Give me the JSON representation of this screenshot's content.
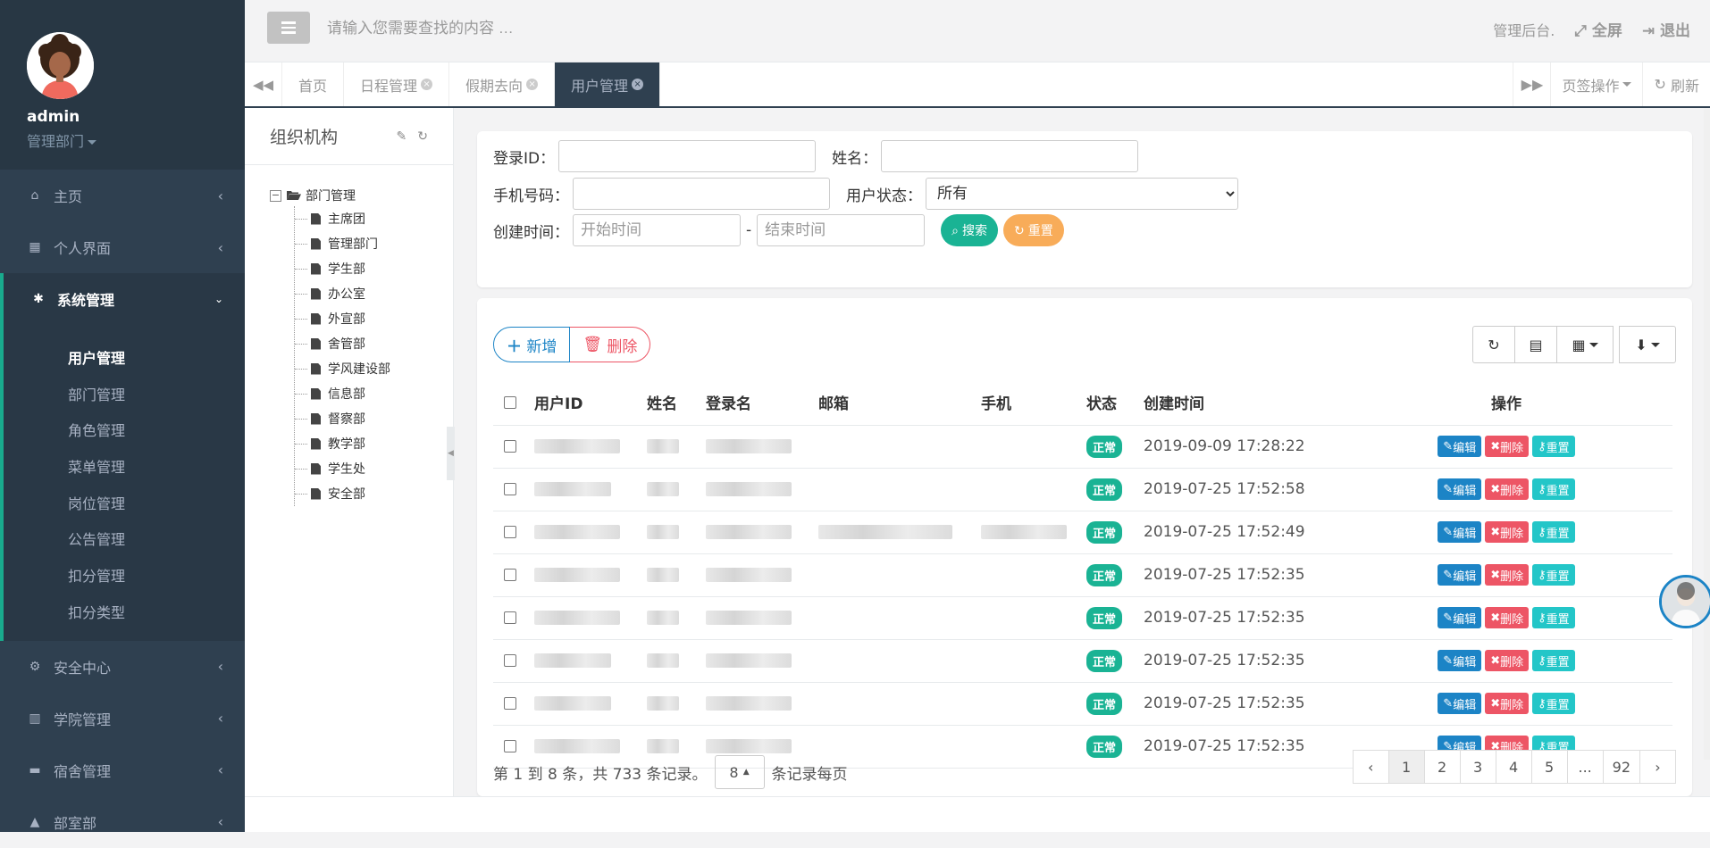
{
  "user": {
    "name": "admin",
    "dept": "管理部门"
  },
  "sidebar": {
    "items": [
      {
        "label": "主页",
        "icon": "home-icon"
      },
      {
        "label": "个人界面",
        "icon": "calendar-icon"
      },
      {
        "label": "系统管理",
        "icon": "gear-icon"
      },
      {
        "label": "安全中心",
        "icon": "gears-icon"
      },
      {
        "label": "学院管理",
        "icon": "bank-icon"
      },
      {
        "label": "宿舍管理",
        "icon": "bed-icon"
      },
      {
        "label": "部室部",
        "icon": "bell-icon"
      }
    ],
    "submenu": [
      "用户管理",
      "部门管理",
      "角色管理",
      "菜单管理",
      "岗位管理",
      "公告管理",
      "扣分管理",
      "扣分类型"
    ]
  },
  "topbar": {
    "search_placeholder": "请输入您需要查找的内容 …",
    "admin_label": "管理后台.",
    "fullscreen": "全屏",
    "logout": "退出"
  },
  "tabs": {
    "items": [
      "首页",
      "日程管理",
      "假期去向",
      "用户管理"
    ],
    "page_ops": "页签操作",
    "refresh": "刷新"
  },
  "tree": {
    "title": "组织机构",
    "root": "部门管理",
    "children": [
      "主席团",
      "管理部门",
      "学生部",
      "办公室",
      "外宣部",
      "舍管部",
      "学风建设部",
      "信息部",
      "督察部",
      "教学部",
      "学生处",
      "安全部"
    ]
  },
  "filters": {
    "login_id_label": "登录ID：",
    "name_label": "姓名：",
    "phone_label": "手机号码：",
    "status_label": "用户状态：",
    "status_value": "所有",
    "time_label": "创建时间：",
    "start_placeholder": "开始时间",
    "end_placeholder": "结束时间",
    "dash": "-",
    "search_btn": "搜索",
    "reset_btn": "重置"
  },
  "toolbar": {
    "add": "新增",
    "delete": "删除"
  },
  "table": {
    "headers": [
      "用户ID",
      "姓名",
      "登录名",
      "邮箱",
      "手机",
      "状态",
      "创建时间",
      "操作"
    ],
    "rows": [
      {
        "status": "正常",
        "created": "2019-09-09 17:28:22"
      },
      {
        "status": "正常",
        "created": "2019-07-25 17:52:58"
      },
      {
        "status": "正常",
        "created": "2019-07-25 17:52:49"
      },
      {
        "status": "正常",
        "created": "2019-07-25 17:52:35"
      },
      {
        "status": "正常",
        "created": "2019-07-25 17:52:35"
      },
      {
        "status": "正常",
        "created": "2019-07-25 17:52:35"
      },
      {
        "status": "正常",
        "created": "2019-07-25 17:52:35"
      },
      {
        "status": "正常",
        "created": "2019-07-25 17:52:35"
      }
    ],
    "ops": {
      "edit": "编辑",
      "delete": "删除",
      "reset": "重置"
    }
  },
  "pager": {
    "info": "第 1 到 8 条，共 733 条记录。",
    "page_size": "8",
    "per_page": "条记录每页",
    "prev": "‹",
    "pages": [
      "1",
      "2",
      "3",
      "4",
      "5",
      "...",
      "92"
    ],
    "next": "›"
  },
  "colors": {
    "sidebar": "#2f4050",
    "accent": "#1ab394",
    "primary": "#1c84c6",
    "danger": "#ed5565",
    "warning": "#f8ac59",
    "info": "#23c6c8"
  }
}
